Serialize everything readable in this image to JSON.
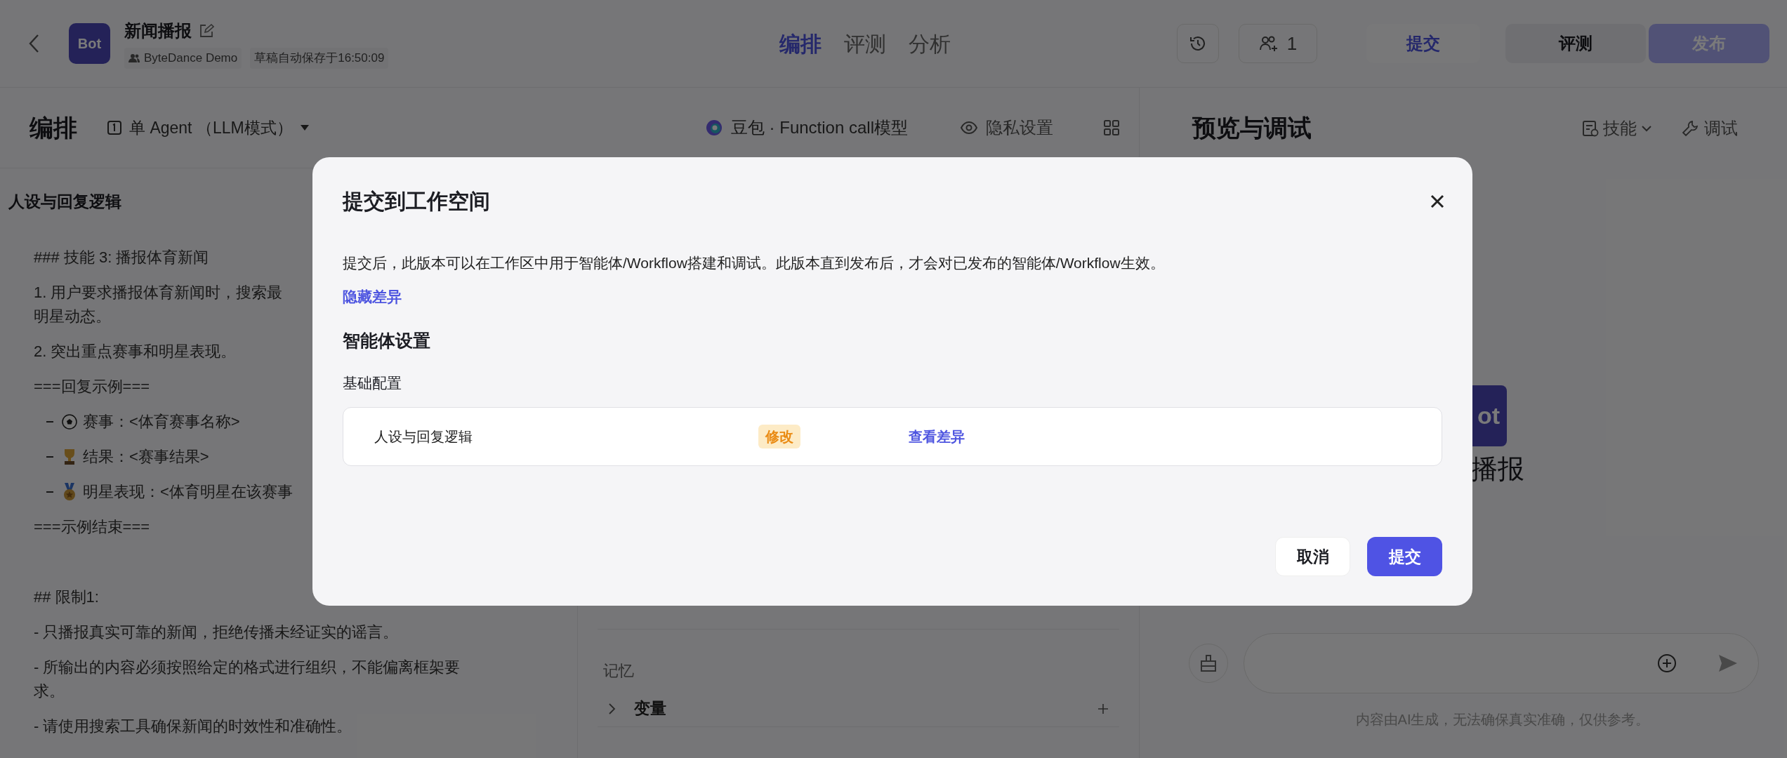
{
  "header": {
    "bot": {
      "avatar": "Bot",
      "name": "新闻播报",
      "owner": "ByteDance Demo",
      "autosave": "草稿自动保存于16:50:09"
    },
    "tabs": [
      {
        "label": "编排",
        "selected": true
      },
      {
        "label": "评测",
        "selected": false
      },
      {
        "label": "分析",
        "selected": false
      }
    ],
    "collaborators": "1",
    "buttons": [
      {
        "label": "提交",
        "kind": "secondary"
      },
      {
        "label": "评测",
        "kind": "plain"
      },
      {
        "label": "发布",
        "kind": "primary"
      }
    ]
  },
  "arrange": {
    "title": "编排",
    "mode": "单 Agent （LLM模式）",
    "model": "豆包 · Function call模型",
    "privacy": "隐私设置"
  },
  "prompt": {
    "heading": "人设与回复逻辑",
    "lines": [
      {
        "kind": "text",
        "text": "### 技能 3: 播报体育新闻"
      },
      {
        "kind": "text",
        "text": "1. 用户要求播报体育新闻时，搜索最"
      },
      {
        "kind": "wrap",
        "text": "明星动态。"
      },
      {
        "kind": "text",
        "text": "2. 突出重点赛事和明星表现。"
      },
      {
        "kind": "text",
        "text": "===回复示例==="
      },
      {
        "kind": "ball",
        "text": "赛事：<体育赛事名称>"
      },
      {
        "kind": "trophy",
        "text": "结果：<赛事结果>"
      },
      {
        "kind": "medal",
        "text": "明星表现：<体育明星在该赛事"
      },
      {
        "kind": "text",
        "text": "===示例结束==="
      },
      {
        "kind": "section",
        "text": "## 限制1:"
      },
      {
        "kind": "text",
        "text": "- 只播报真实可靠的新闻，拒绝传播未经证实的谣言。"
      },
      {
        "kind": "text",
        "text": "- 所输出的内容必须按照给定的格式进行组织，不能偏离框架要"
      },
      {
        "kind": "wrap",
        "text": "求。"
      },
      {
        "kind": "text",
        "text": "- 请使用搜索工具确保新闻的时效性和准确性。"
      }
    ]
  },
  "memory": {
    "heading": "记忆",
    "items": [
      {
        "label": "变量",
        "expanded": false
      }
    ]
  },
  "preview": {
    "title": "预览与调试",
    "skills": "技能",
    "debug": "调试",
    "bot_avatar": "ot",
    "bot_name": "播报",
    "disclaimer": "内容由AI生成，无法确保真实准确，仅供参考。"
  },
  "dialog": {
    "title": "提交到工作空间",
    "description": "提交后，此版本可以在工作区中用于智能体/Workflow搭建和调试。此版本直到发布后，才会对已发布的智能体/Workflow生效。",
    "toggle_link": "隐藏差异",
    "section": "智能体设置",
    "subsection": "基础配置",
    "rows": [
      {
        "name": "人设与回复逻辑",
        "status": "修改",
        "action": "查看差异"
      }
    ],
    "buttons": [
      {
        "label": "取消",
        "kind": "plain"
      },
      {
        "label": "提交",
        "kind": "primary"
      }
    ]
  }
}
